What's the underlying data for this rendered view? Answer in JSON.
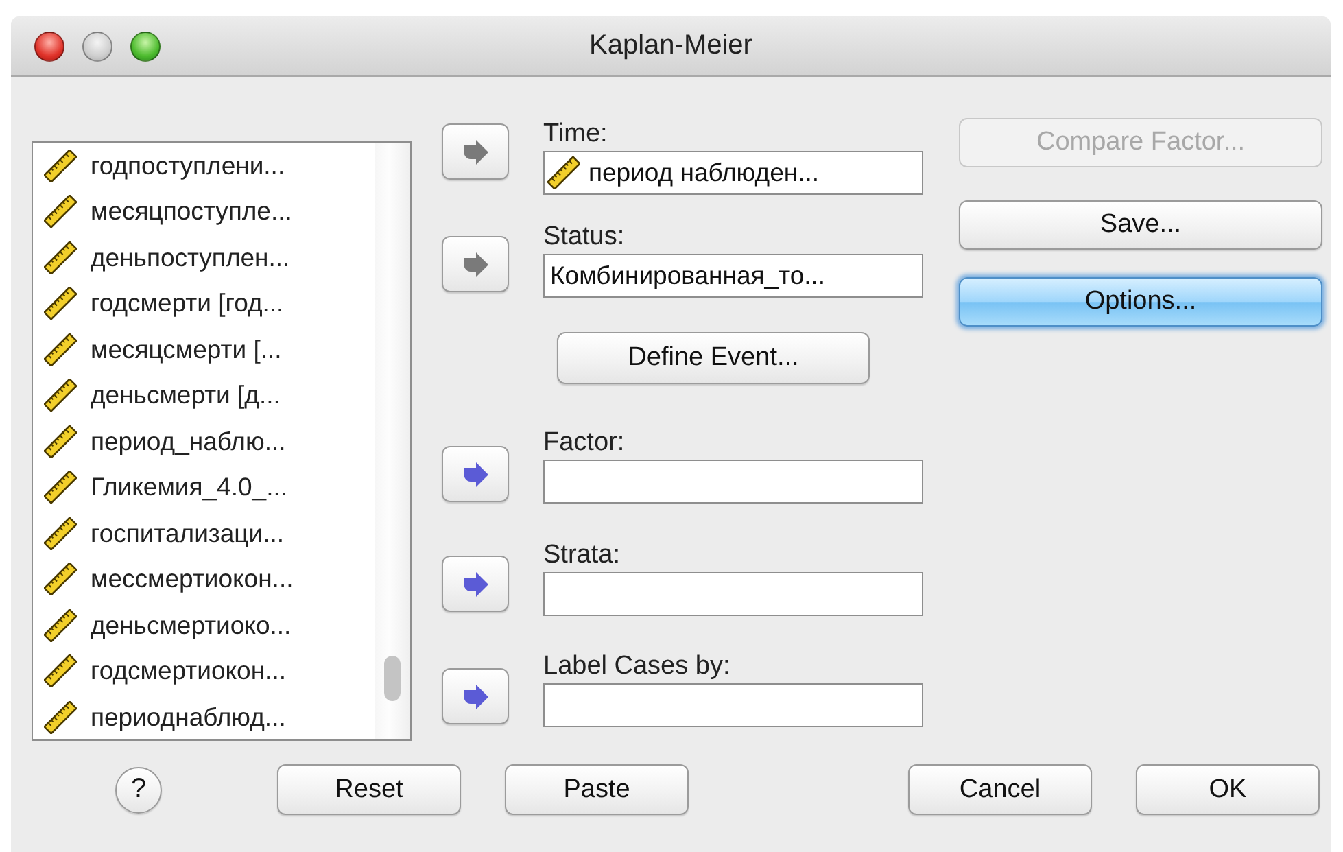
{
  "window": {
    "title": "Kaplan-Meier"
  },
  "variables": [
    {
      "name": "годпоступлени..."
    },
    {
      "name": "месяцпоступле..."
    },
    {
      "name": "деньпоступлен..."
    },
    {
      "name": "годсмерти [год..."
    },
    {
      "name": "месяцсмерти [..."
    },
    {
      "name": "деньсмерти [д..."
    },
    {
      "name": "период_наблю..."
    },
    {
      "name": "Гликемия_4.0_..."
    },
    {
      "name": "госпитализаци..."
    },
    {
      "name": "мессмертиокон..."
    },
    {
      "name": "деньсмертиоко..."
    },
    {
      "name": "годсмертиокон..."
    },
    {
      "name": "периоднаблюд..."
    }
  ],
  "targets": [
    {
      "label": "Time:",
      "kind": "variable",
      "value": "период наблюден...",
      "arrow_enabled": false
    },
    {
      "label": "Status:",
      "kind": "text",
      "value": "Комбинированная_то...",
      "arrow_enabled": false
    },
    {
      "label": "Factor:",
      "kind": "empty",
      "arrow_enabled": true
    },
    {
      "label": "Strata:",
      "kind": "empty",
      "arrow_enabled": true
    },
    {
      "label": "Label Cases by:",
      "kind": "empty",
      "arrow_enabled": true
    }
  ],
  "define_event_button": {
    "label": "Define Event..."
  },
  "side_buttons": [
    {
      "label": "Compare Factor...",
      "disabled": true,
      "default": false
    },
    {
      "label": "Save...",
      "disabled": false,
      "default": false
    },
    {
      "label": "Options...",
      "disabled": false,
      "default": true
    }
  ],
  "help_button": {
    "label": "?"
  },
  "bottom_buttons": [
    {
      "label": "Reset"
    },
    {
      "label": "Paste"
    },
    {
      "label": "Cancel"
    },
    {
      "label": "OK"
    }
  ]
}
